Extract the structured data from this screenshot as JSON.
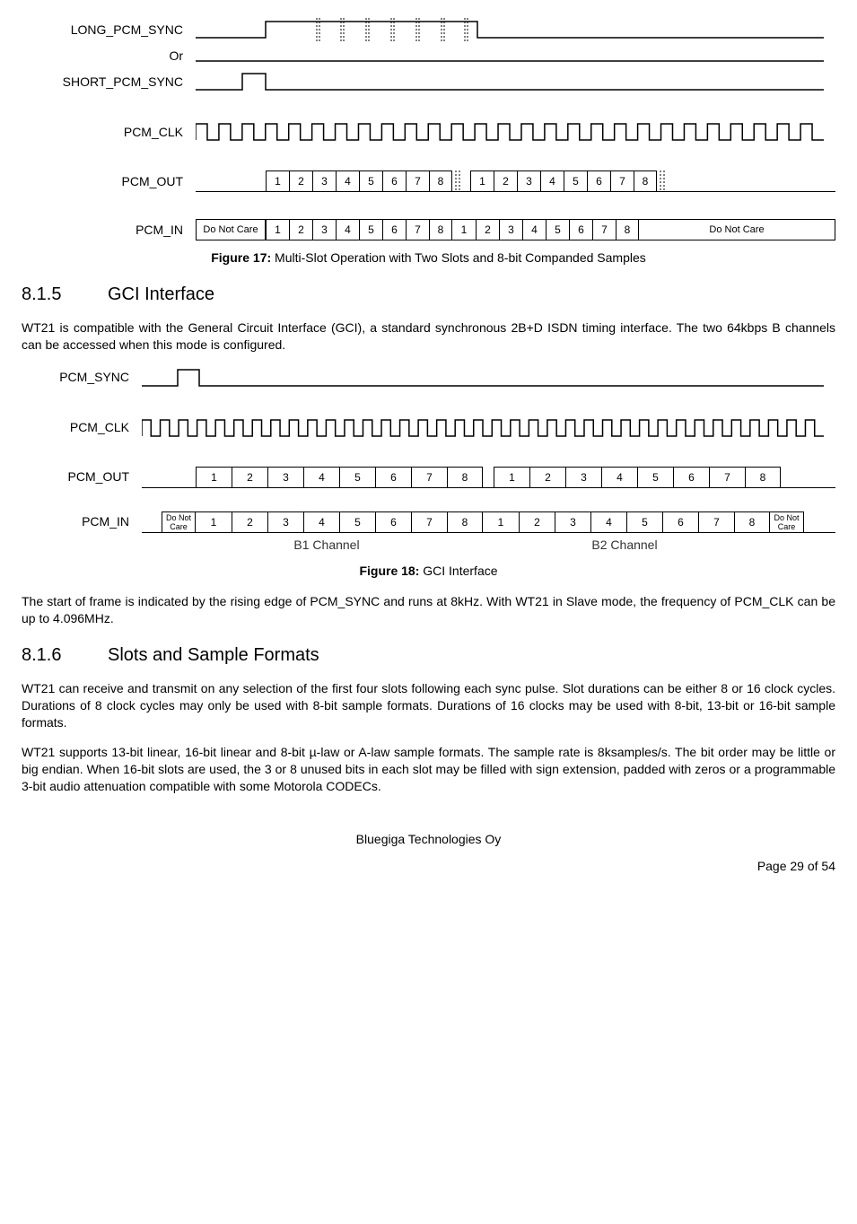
{
  "fig17": {
    "label": "Figure 17:",
    "caption": "Multi-Slot Operation with Two Slots and 8-bit Companded Samples",
    "signals": {
      "long_sync": "LONG_PCM_SYNC",
      "or": "Or",
      "short_sync": "SHORT_PCM_SYNC",
      "clk": "PCM_CLK",
      "out": "PCM_OUT",
      "in": "PCM_IN"
    },
    "out_bits_a": [
      "1",
      "2",
      "3",
      "4",
      "5",
      "6",
      "7",
      "8"
    ],
    "out_bits_b": [
      "1",
      "2",
      "3",
      "4",
      "5",
      "6",
      "7",
      "8"
    ],
    "in_bits_a": [
      "1",
      "2",
      "3",
      "4",
      "5",
      "6",
      "7",
      "8"
    ],
    "in_bits_b": [
      "1",
      "2",
      "3",
      "4",
      "5",
      "6",
      "7",
      "8"
    ],
    "dnc_left": "Do Not Care",
    "dnc_right": "Do Not Care"
  },
  "section815": {
    "num": "8.1.5",
    "title": "GCI Interface",
    "p1": "WT21 is compatible with the General Circuit Interface (GCI), a standard synchronous 2B+D ISDN timing interface. The two 64kbps B channels can be accessed when this mode is configured."
  },
  "fig18": {
    "label": "Figure 18:",
    "caption": "GCI Interface",
    "signals": {
      "sync": "PCM_SYNC",
      "clk": "PCM_CLK",
      "out": "PCM_OUT",
      "in": "PCM_IN"
    },
    "out_bits_a": [
      "1",
      "2",
      "3",
      "4",
      "5",
      "6",
      "7",
      "8"
    ],
    "out_bits_b": [
      "1",
      "2",
      "3",
      "4",
      "5",
      "6",
      "7",
      "8"
    ],
    "in_bits_a": [
      "1",
      "2",
      "3",
      "4",
      "5",
      "6",
      "7",
      "8"
    ],
    "in_bits_b": [
      "1",
      "2",
      "3",
      "4",
      "5",
      "6",
      "7",
      "8"
    ],
    "dnc_left": "Do Not\nCare",
    "dnc_right": "Do Not\nCare",
    "b1": "B1 Channel",
    "b2": "B2 Channel",
    "p_after": "The start of frame is indicated by the rising edge of PCM_SYNC and runs at 8kHz. With WT21 in Slave mode, the frequency of PCM_CLK can be up to 4.096MHz."
  },
  "section816": {
    "num": "8.1.6",
    "title": "Slots and Sample Formats",
    "p1": "WT21 can receive and transmit on any selection of the first four slots following each sync pulse. Slot durations can be either 8 or 16 clock cycles. Durations of 8 clock cycles may only be used with 8-bit sample formats. Durations of 16 clocks may be used with 8-bit, 13-bit or 16-bit sample formats.",
    "p2": "WT21 supports 13-bit linear, 16-bit linear and 8-bit µ-law or A-law sample formats. The sample rate is 8ksamples/s. The bit order may be little or big endian. When 16-bit slots are used, the 3 or 8 unused bits in each slot may be filled with sign extension, padded with zeros or a programmable 3-bit audio attenuation compatible with some Motorola CODECs."
  },
  "footer": {
    "company": "Bluegiga Technologies Oy",
    "page": "Page 29 of 54"
  }
}
